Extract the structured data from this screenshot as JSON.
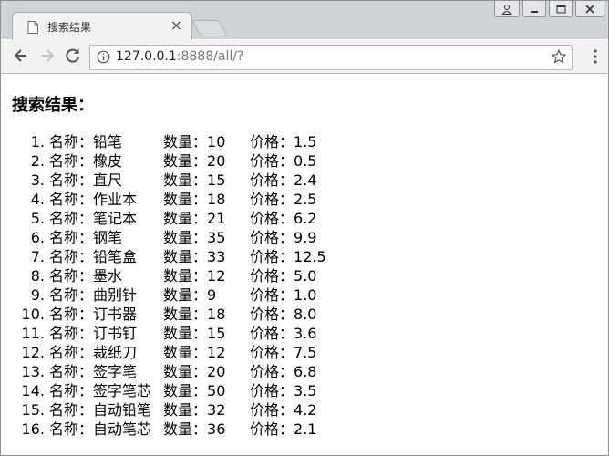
{
  "browser": {
    "tab_title": "搜索结果",
    "tab_close": "×",
    "url_host": "127.0.0.1",
    "url_rest": ":8888/all/?"
  },
  "page": {
    "heading": "搜索结果：",
    "name_label": "名称：",
    "qty_label": "数量：",
    "price_label": "价格：",
    "items": [
      {
        "num": "1.",
        "name": "铅笔",
        "qty": "10",
        "price": "1.5"
      },
      {
        "num": "2.",
        "name": "橡皮",
        "qty": "20",
        "price": "0.5"
      },
      {
        "num": "3.",
        "name": "直尺",
        "qty": "15",
        "price": "2.4"
      },
      {
        "num": "4.",
        "name": "作业本",
        "qty": "18",
        "price": "2.5"
      },
      {
        "num": "5.",
        "name": "笔记本",
        "qty": "21",
        "price": "6.2"
      },
      {
        "num": "6.",
        "name": "钢笔",
        "qty": "35",
        "price": "9.9"
      },
      {
        "num": "7.",
        "name": "铅笔盒",
        "qty": "33",
        "price": "12.5"
      },
      {
        "num": "8.",
        "name": "墨水",
        "qty": "12",
        "price": "5.0"
      },
      {
        "num": "9.",
        "name": "曲别针",
        "qty": "9",
        "price": "1.0"
      },
      {
        "num": "10.",
        "name": "订书器",
        "qty": "18",
        "price": "8.0"
      },
      {
        "num": "11.",
        "name": "订书钉",
        "qty": "15",
        "price": "3.6"
      },
      {
        "num": "12.",
        "name": "裁纸刀",
        "qty": "12",
        "price": "7.5"
      },
      {
        "num": "13.",
        "name": "签字笔",
        "qty": "20",
        "price": "6.8"
      },
      {
        "num": "14.",
        "name": "签字笔芯",
        "qty": "50",
        "price": "3.5"
      },
      {
        "num": "15.",
        "name": "自动铅笔",
        "qty": "32",
        "price": "4.2"
      },
      {
        "num": "16.",
        "name": "自动笔芯",
        "qty": "36",
        "price": "2.1"
      }
    ]
  },
  "icons": {
    "page": "page-icon",
    "back": "arrow-left-icon",
    "forward": "arrow-right-icon",
    "reload": "reload-icon",
    "info": "info-icon",
    "star": "star-icon",
    "menu": "vertical-dots-icon",
    "profile": "user-icon",
    "minimize": "minimize-icon",
    "maximize": "maximize-icon",
    "close": "close-icon"
  }
}
